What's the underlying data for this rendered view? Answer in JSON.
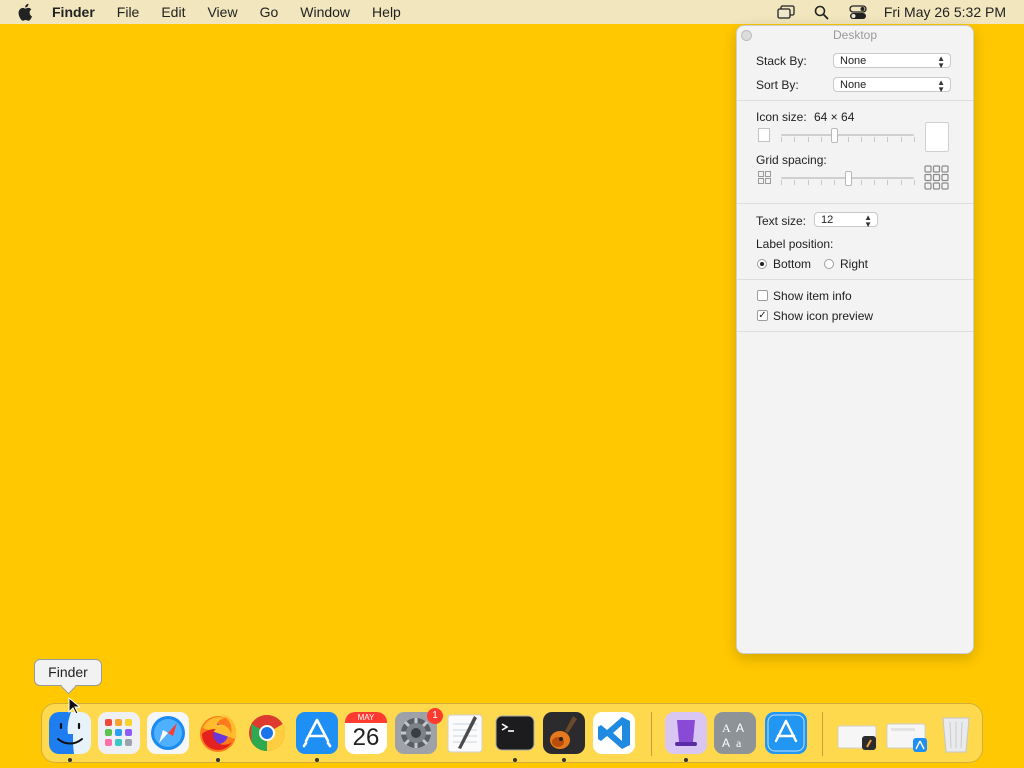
{
  "menubar": {
    "app_name": "Finder",
    "items": [
      "File",
      "Edit",
      "View",
      "Go",
      "Window",
      "Help"
    ],
    "clock": "Fri May 26  5:32 PM"
  },
  "panel": {
    "title": "Desktop",
    "stack_by_label": "Stack By:",
    "stack_by_value": "None",
    "sort_by_label": "Sort By:",
    "sort_by_value": "None",
    "icon_size_label": "Icon size:",
    "icon_size_value": "64 × 64",
    "icon_size_level": 0.4,
    "grid_spacing_label": "Grid spacing:",
    "grid_spacing_level": 0.5,
    "text_size_label": "Text size:",
    "text_size_value": "12",
    "label_position_label": "Label position:",
    "label_bottom": "Bottom",
    "label_right": "Right",
    "selected_label_position": "Bottom",
    "show_item_info": "Show item info",
    "show_item_info_checked": false,
    "show_icon_preview": "Show icon preview",
    "show_icon_preview_checked": true
  },
  "tooltip": "Finder",
  "dock": {
    "calendar_month": "MAY",
    "calendar_day": "26",
    "settings_badge": "1",
    "apps": [
      "finder",
      "launchpad",
      "safari",
      "firefox",
      "chrome",
      "app-store",
      "calendar",
      "system-settings",
      "textedit",
      "terminal",
      "garageband",
      "vscode",
      "bbedit",
      "font-book",
      "xcode-installer",
      "downloads-stack",
      "apps-stack",
      "trash"
    ]
  },
  "colors": {
    "desktop": "#FFC800",
    "accent": "#0a7cf3",
    "badge": "#ff3b30"
  }
}
